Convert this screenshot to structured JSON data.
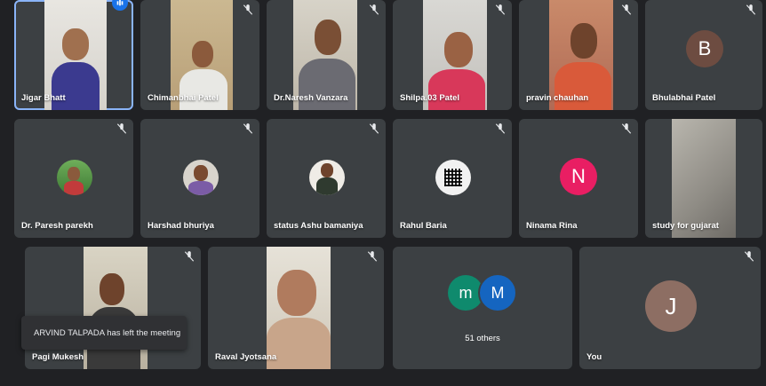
{
  "participants": [
    {
      "name": "Jigar Bhatt"
    },
    {
      "name": "Chimanbhai Patel"
    },
    {
      "name": "Dr.Naresh Vanzara"
    },
    {
      "name": "Shilpa.03 Patel"
    },
    {
      "name": "pravin chauhan"
    },
    {
      "name": "Bhulabhai Patel",
      "initial": "B",
      "avatar_color": "#6d4c41"
    },
    {
      "name": "Dr. Paresh parekh"
    },
    {
      "name": "Harshad bhuriya"
    },
    {
      "name": "status Ashu bamaniya"
    },
    {
      "name": "Rahul Baria"
    },
    {
      "name": "Ninama Rina",
      "initial": "N",
      "avatar_color": "#e91e63"
    },
    {
      "name": "study for gujarat"
    },
    {
      "name": "Pagi Mukesh"
    },
    {
      "name": "Raval Jyotsana"
    },
    {
      "name": "You",
      "initial": "J",
      "avatar_color": "#8d6e63"
    }
  ],
  "others": {
    "label": "51 others",
    "avatars": [
      {
        "initial": "m",
        "color": "#0f8a6d"
      },
      {
        "initial": "M",
        "color": "#1565c0"
      }
    ]
  },
  "toast": {
    "text": "ARVIND TALPADA has left the meeting"
  },
  "colors": {
    "active_outline": "#8ab4f8",
    "tile": "#3c4043",
    "background": "#202124"
  }
}
